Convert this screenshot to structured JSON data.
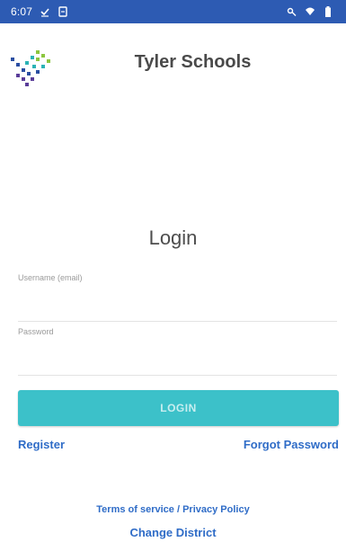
{
  "status_bar": {
    "time": "6:07",
    "icons": [
      "check-icon",
      "sim-icon",
      "key-icon",
      "wifi-icon",
      "battery-icon"
    ],
    "background": "#2d5bb3"
  },
  "header": {
    "title": "Tyler Schools",
    "logo_icon": "tyler-logo-icon"
  },
  "login": {
    "title": "Login",
    "username": {
      "label": "Username (email)",
      "value": ""
    },
    "password": {
      "label": "Password",
      "value": ""
    },
    "button_label": "LOGIN",
    "button_color": "#3cc1c9"
  },
  "links": {
    "register": "Register",
    "forgot_password": "Forgot Password",
    "terms": "Terms of service",
    "separator": "/",
    "privacy": "Privacy Policy",
    "change_district": "Change District",
    "link_color": "#2f6cc7"
  }
}
